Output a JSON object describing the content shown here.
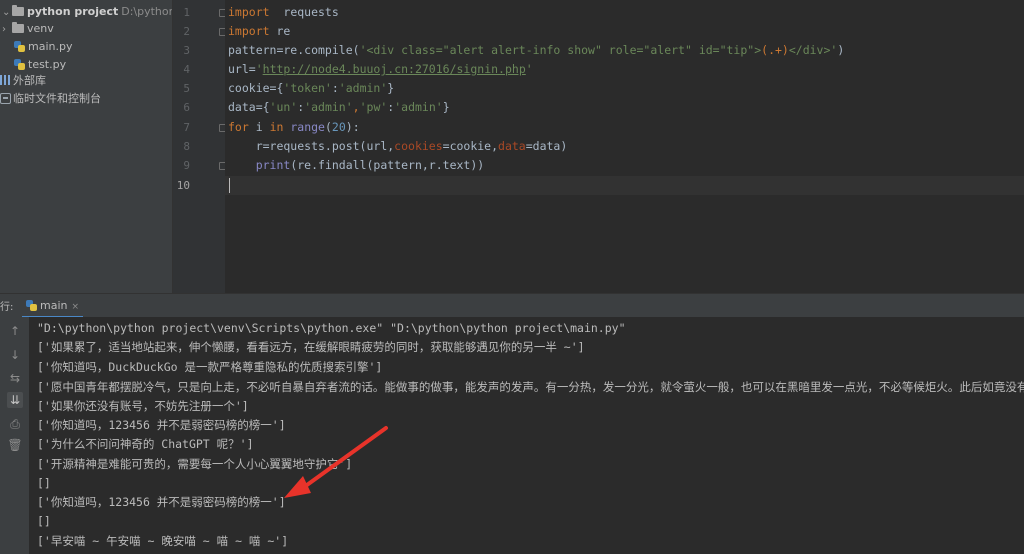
{
  "project": {
    "root_name": "python project",
    "root_path": "D:\\python\\pyt",
    "items": [
      {
        "label": "venv"
      },
      {
        "label": "main.py"
      },
      {
        "label": "test.py"
      },
      {
        "label": "外部库"
      },
      {
        "label": "临时文件和控制台"
      }
    ]
  },
  "editor": {
    "line_numbers": [
      "1",
      "2",
      "3",
      "4",
      "5",
      "6",
      "7",
      "8",
      "9",
      "10"
    ],
    "code": {
      "l1_kw": "import",
      "l1_rest": "  requests",
      "l2_kw": "import",
      "l2_rest": " re",
      "l3_pre": "pattern=re.compile(",
      "l3_str1": "'<div class=\"alert alert-info show\" role=\"alert\" id=\"tip\">",
      "l3_esc": "(.+)",
      "l3_str2": "</div>'",
      "l3_post": ")",
      "l4_pre": "url=",
      "l4_q1": "'",
      "l4_url": "http://node4.buuoj.cn:27016/signin.php",
      "l4_q2": "'",
      "l5_pre": "cookie={",
      "l5_k": "'token'",
      "l5_mid": ":",
      "l5_v": "'admin'",
      "l5_post": "}",
      "l6_pre": "data={",
      "l6_k1": "'un'",
      "l6_c1": ":",
      "l6_v1": "'admin'",
      "l6_sep": ",",
      "l6_k2": "'pw'",
      "l6_c2": ":",
      "l6_v2": "'admin'",
      "l6_post": "}",
      "l7_for": "for",
      "l7_mid": " i ",
      "l7_in": "in",
      "l7_sp": " ",
      "l7_range": "range",
      "l7_open": "(",
      "l7_num": "20",
      "l7_close": "):",
      "l8_pre": "    r=requests.post(url,",
      "l8_kw1": "cookies",
      "l8_mid": "=cookie,",
      "l8_kw2": "data",
      "l8_post": "=data)",
      "l9_pre": "    ",
      "l9_print": "print",
      "l9_post": "(re.findall(pattern,r.text))"
    }
  },
  "run": {
    "panel_label": "行:",
    "tab_label": "main",
    "tab_close": "×",
    "tools": [
      "↑",
      "↓",
      "⇆",
      "⇊",
      "⎙",
      "🗑"
    ],
    "output": [
      "\"D:\\python\\python project\\venv\\Scripts\\python.exe\" \"D:\\python\\python project\\main.py\"",
      "['如果累了，适当地站起来，伸个懒腰，看看远方，在缓解眼睛疲劳的同时，获取能够遇见你的另一半 ~']",
      "['你知道吗，DuckDuckGo 是一款严格尊重隐私的优质搜索引擎']",
      "['愿中国青年都摆脱冷气，只是向上走，不必听自暴自弃者流的话。能做事的做事，能发声的发声。有一分热，发一分光，就令萤火一般，也可以在黑暗里发一点光，不必等候炬火。此后如竟没有炬火",
      "['如果你还没有账号，不妨先注册一个']",
      "['你知道吗，123456 并不是弱密码榜的榜一']",
      "['为什么不问问神奇的 ChatGPT 呢？']",
      "['开源精神是难能可贵的，需要每一个人小心翼翼地守护它']",
      "[]",
      "['你知道吗，123456 并不是弱密码榜的榜一']",
      "[]",
      "['早安喵 ~ 午安喵 ~ 晚安喵 ~ 喵 ~ 喵 ~']"
    ]
  },
  "colors": {
    "annotation_arrow": "#e8332a"
  }
}
